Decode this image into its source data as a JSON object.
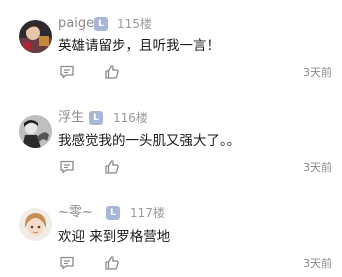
{
  "comments": [
    {
      "author": "paige",
      "floor": "115楼",
      "text": "英雄请留步，且听我一言！",
      "time": "3天前"
    },
    {
      "author": "浮生",
      "floor": "116楼",
      "text": "我感觉我的一头肌又强大了。。",
      "time": "3天前"
    },
    {
      "author": "~零~",
      "floor": "117楼",
      "text": "欢迎 来到罗格营地",
      "time": "3天前"
    }
  ],
  "colors": {
    "badge": "#a8b7d8",
    "name": "#8a8a8a",
    "text": "#1a1a1a",
    "icon": "#8a8a8a"
  },
  "icons": [
    "reply-icon",
    "like-icon",
    "level-badge-icon"
  ]
}
